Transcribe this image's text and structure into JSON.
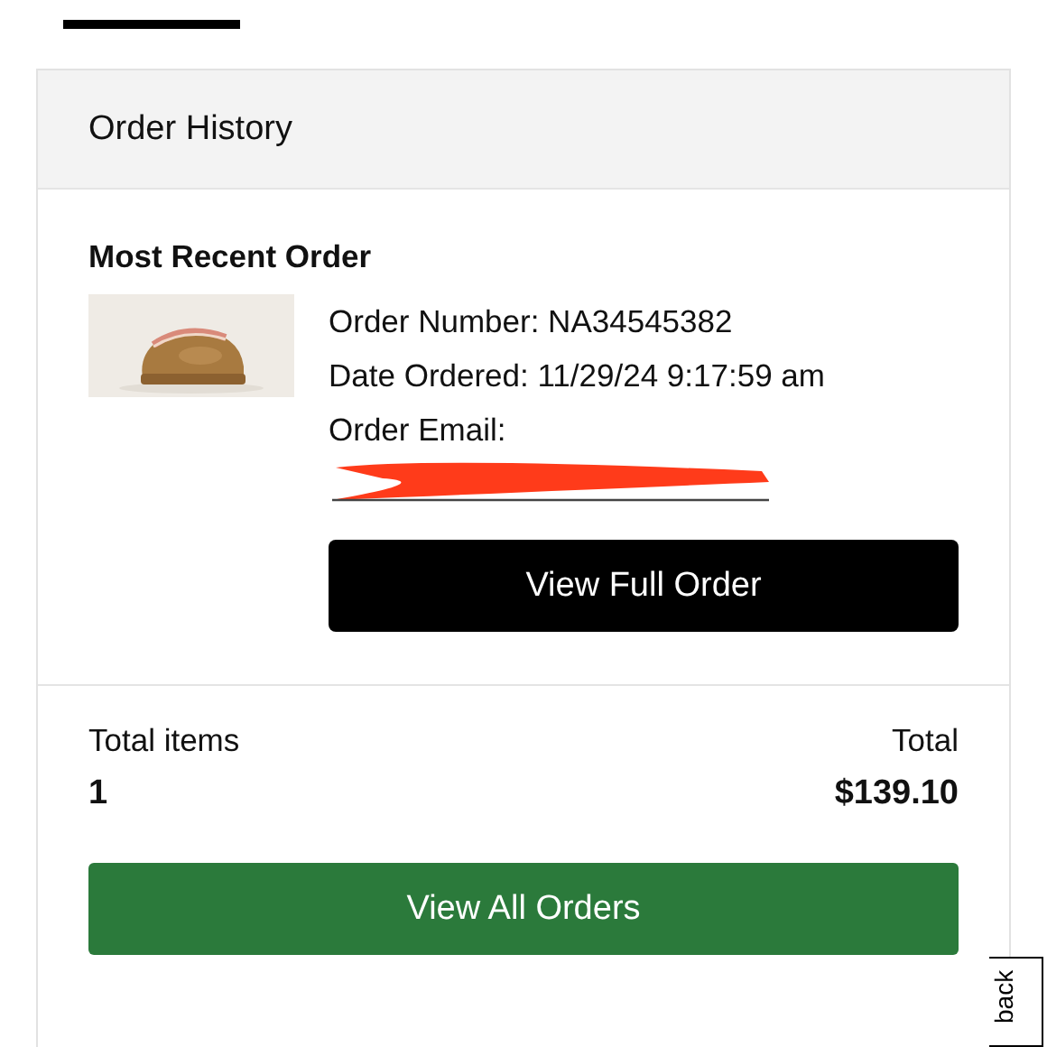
{
  "tab_bar": {
    "tabs": [
      {
        "selected": true
      }
    ]
  },
  "order_history": {
    "title": "Order History",
    "section_title": "Most Recent Order",
    "order_number": "Order Number: NA34545382",
    "date_ordered": "Date Ordered: 11/29/24 9:17:59 am",
    "order_email_label": "Order Email:",
    "view_full_order_button": "View Full Order",
    "total_items_label": "Total items",
    "total_items_value": "1",
    "total_label": "Total",
    "total_value": "$139.10",
    "view_all_orders_button": "View All Orders"
  },
  "feedback_tab": {
    "label": "back"
  }
}
